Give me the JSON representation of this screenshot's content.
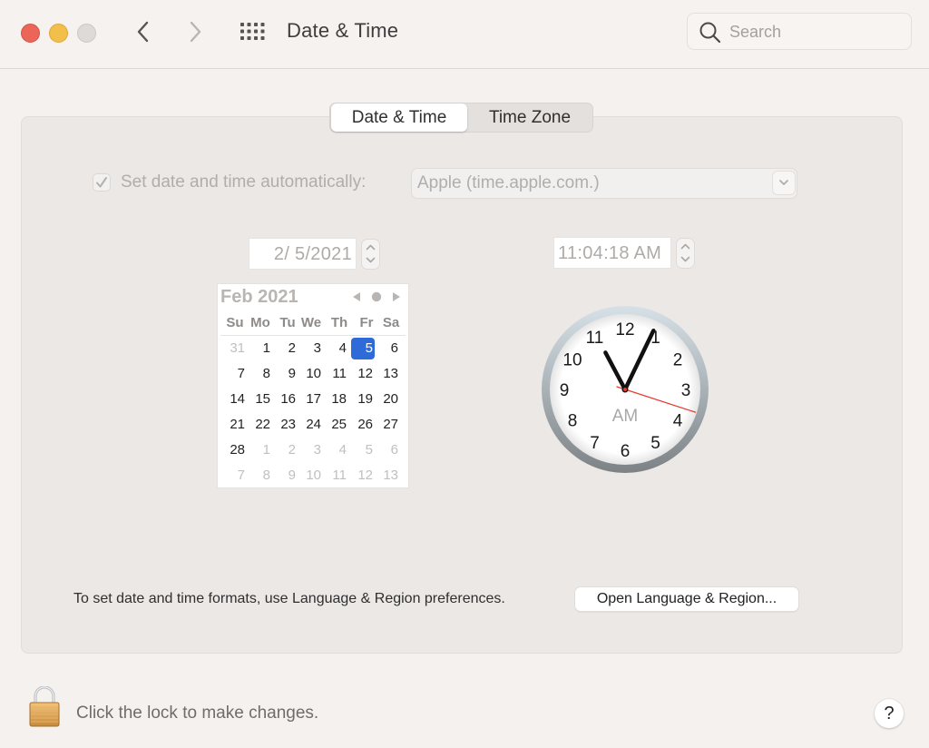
{
  "window": {
    "title": "Date & Time",
    "search_placeholder": "Search"
  },
  "tabs": [
    {
      "label": "Date & Time",
      "active": true
    },
    {
      "label": "Time Zone",
      "active": false
    }
  ],
  "auto": {
    "label": "Set date and time automatically:",
    "checked": true,
    "server": "Apple (time.apple.com.)"
  },
  "date_field": {
    "value": "2/  5/2021"
  },
  "time_field": {
    "value": "11:04:18 AM"
  },
  "calendar": {
    "title": "Feb 2021",
    "weekdays": [
      "Su",
      "Mo",
      "Tu",
      "We",
      "Th",
      "Fr",
      "Sa"
    ],
    "selected_day": 5,
    "weeks": [
      [
        {
          "d": "31",
          "m": true
        },
        {
          "d": "1"
        },
        {
          "d": "2"
        },
        {
          "d": "3"
        },
        {
          "d": "4"
        },
        {
          "d": "5",
          "s": true
        },
        {
          "d": "6"
        }
      ],
      [
        {
          "d": "7"
        },
        {
          "d": "8"
        },
        {
          "d": "9"
        },
        {
          "d": "10"
        },
        {
          "d": "11"
        },
        {
          "d": "12"
        },
        {
          "d": "13"
        }
      ],
      [
        {
          "d": "14"
        },
        {
          "d": "15"
        },
        {
          "d": "16"
        },
        {
          "d": "17"
        },
        {
          "d": "18"
        },
        {
          "d": "19"
        },
        {
          "d": "20"
        }
      ],
      [
        {
          "d": "21"
        },
        {
          "d": "22"
        },
        {
          "d": "23"
        },
        {
          "d": "24"
        },
        {
          "d": "25"
        },
        {
          "d": "26"
        },
        {
          "d": "27"
        }
      ],
      [
        {
          "d": "28"
        },
        {
          "d": "1",
          "m": true
        },
        {
          "d": "2",
          "m": true
        },
        {
          "d": "3",
          "m": true
        },
        {
          "d": "4",
          "m": true
        },
        {
          "d": "5",
          "m": true
        },
        {
          "d": "6",
          "m": true
        }
      ],
      [
        {
          "d": "7",
          "m": true
        },
        {
          "d": "8",
          "m": true
        },
        {
          "d": "9",
          "m": true
        },
        {
          "d": "10",
          "m": true
        },
        {
          "d": "11",
          "m": true
        },
        {
          "d": "12",
          "m": true
        },
        {
          "d": "13",
          "m": true
        }
      ]
    ]
  },
  "clock": {
    "hours": 11,
    "minutes": 4,
    "seconds": 18,
    "meridiem": "AM",
    "numerals": [
      "12",
      "1",
      "2",
      "3",
      "4",
      "5",
      "6",
      "7",
      "8",
      "9",
      "10",
      "11"
    ],
    "second_hand_color": "#e8392c",
    "accent": "#2f6bd8"
  },
  "footer": {
    "formats_text": "To set date and time formats, use Language & Region preferences.",
    "lang_button": "Open Language & Region...",
    "lock_text": "Click the lock to make changes.",
    "help_label": "?"
  }
}
